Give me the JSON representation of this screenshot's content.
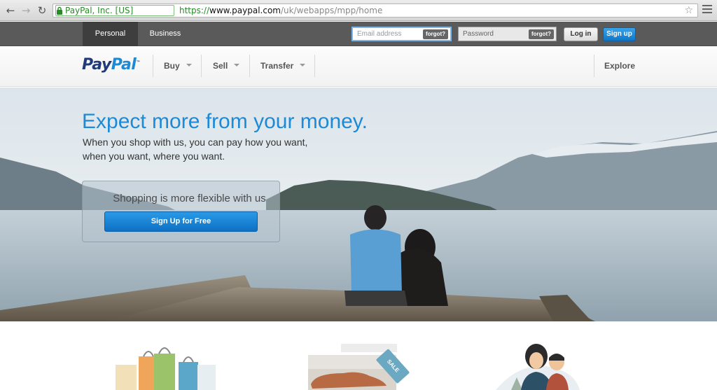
{
  "browser": {
    "ev_label": "PayPal, Inc. [US]",
    "url_proto": "https://",
    "url_host": "www.paypal.com",
    "url_path": "/uk/webapps/mpp/home",
    "back_icon": "back-arrow-icon",
    "forward_icon": "forward-arrow-icon",
    "reload_icon": "reload-icon",
    "star_icon": "bookmark-star-icon",
    "menu_icon": "hamburger-menu-icon"
  },
  "topbar": {
    "tabs": [
      {
        "label": "Personal",
        "active": true
      },
      {
        "label": "Business",
        "active": false
      }
    ],
    "email_placeholder": "Email address",
    "password_placeholder": "Password",
    "forgot_label": "forgot?",
    "login_label": "Log in",
    "signup_label": "Sign up"
  },
  "header": {
    "logo_pay": "Pay",
    "logo_pal": "Pal",
    "logo_tm": "™",
    "menu": [
      {
        "label": "Buy"
      },
      {
        "label": "Sell"
      },
      {
        "label": "Transfer"
      }
    ],
    "explore_label": "Explore"
  },
  "hero": {
    "title": "Expect more from your money.",
    "subtitle_line1": "When you shop with us, you can pay how you want,",
    "subtitle_line2": "when you want, where you want.",
    "cta_text": "Shopping is more flexible with us",
    "cta_button": "Sign Up for Free",
    "sale_tag": "SALE"
  },
  "colors": {
    "brand_dark": "#1f3b7a",
    "brand_light": "#1e8ad6",
    "topbar": "#5a5a5a",
    "cta_blue": "#0e70c4"
  }
}
